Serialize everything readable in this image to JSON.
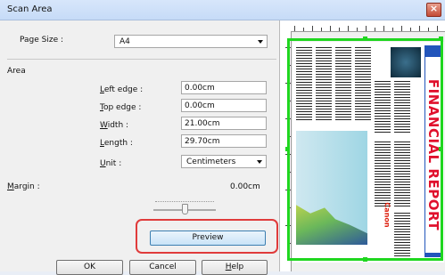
{
  "window": {
    "title": "Scan Area",
    "close_glyph": "×"
  },
  "page_size": {
    "label": "Page Size :",
    "value": "A4"
  },
  "area": {
    "label": "Area",
    "left_edge": {
      "label_first": "L",
      "label_rest": "eft edge :",
      "value": "0.00cm"
    },
    "top_edge": {
      "label_first": "T",
      "label_rest": "op edge :",
      "value": "0.00cm"
    },
    "width": {
      "label_first": "W",
      "label_rest": "idth :",
      "value": "21.00cm"
    },
    "length": {
      "label_first": "L",
      "label_rest": "ength :",
      "value": "29.70cm"
    },
    "unit": {
      "label_first": "U",
      "label_rest": "nit :",
      "value": "Centimeters"
    }
  },
  "margin": {
    "label_first": "M",
    "label_rest": "argin :",
    "value": "0.00cm"
  },
  "buttons": {
    "preview": "Preview",
    "ok": "OK",
    "cancel": "Cancel",
    "help_first": "H",
    "help_rest": "elp"
  },
  "preview_pane": {
    "banner_text": "FINANCIAL REPORT",
    "brand": "Canon"
  },
  "colors": {
    "selection": "#1fd61f",
    "highlight": "#e03b3b",
    "banner": "#2255bb"
  }
}
